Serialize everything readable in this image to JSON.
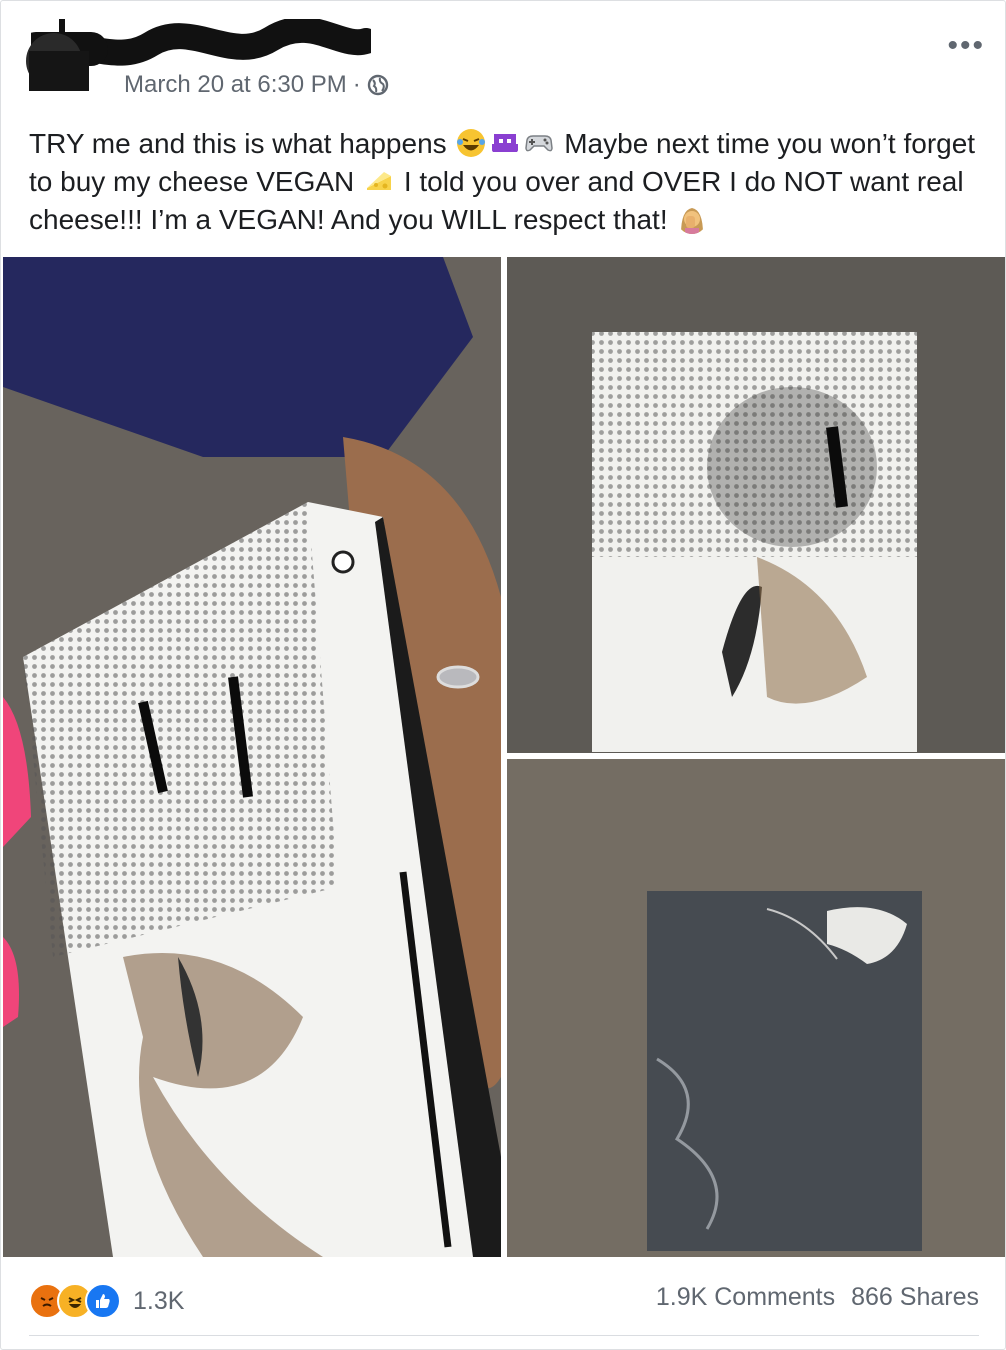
{
  "post": {
    "timestamp": "March 20 at 6:30 PM",
    "separator": "·",
    "text_segments": [
      "TRY me and this is what happens",
      "Maybe next time you won’t forget to buy my cheese VEGAN",
      "I told you over and OVER I do NOT want real cheese!!! I’m a VEGAN! And you WILL respect that!"
    ],
    "emojis": [
      "laughing-crying-emoji",
      "alien-monster-emoji",
      "game-controller-emoji",
      "cheese-emoji",
      "facepalm-woman-emoji"
    ]
  },
  "reactions": {
    "icons": [
      "angry-reaction",
      "haha-reaction",
      "like-reaction"
    ],
    "count": "1.3K"
  },
  "stats": {
    "comments": "1.9K Comments",
    "shares": "866 Shares"
  },
  "colors": {
    "meta_text": "#606770",
    "like_blue": "#1877f2",
    "angry_orange": "#e9710f",
    "haha_yellow": "#f7b125"
  }
}
